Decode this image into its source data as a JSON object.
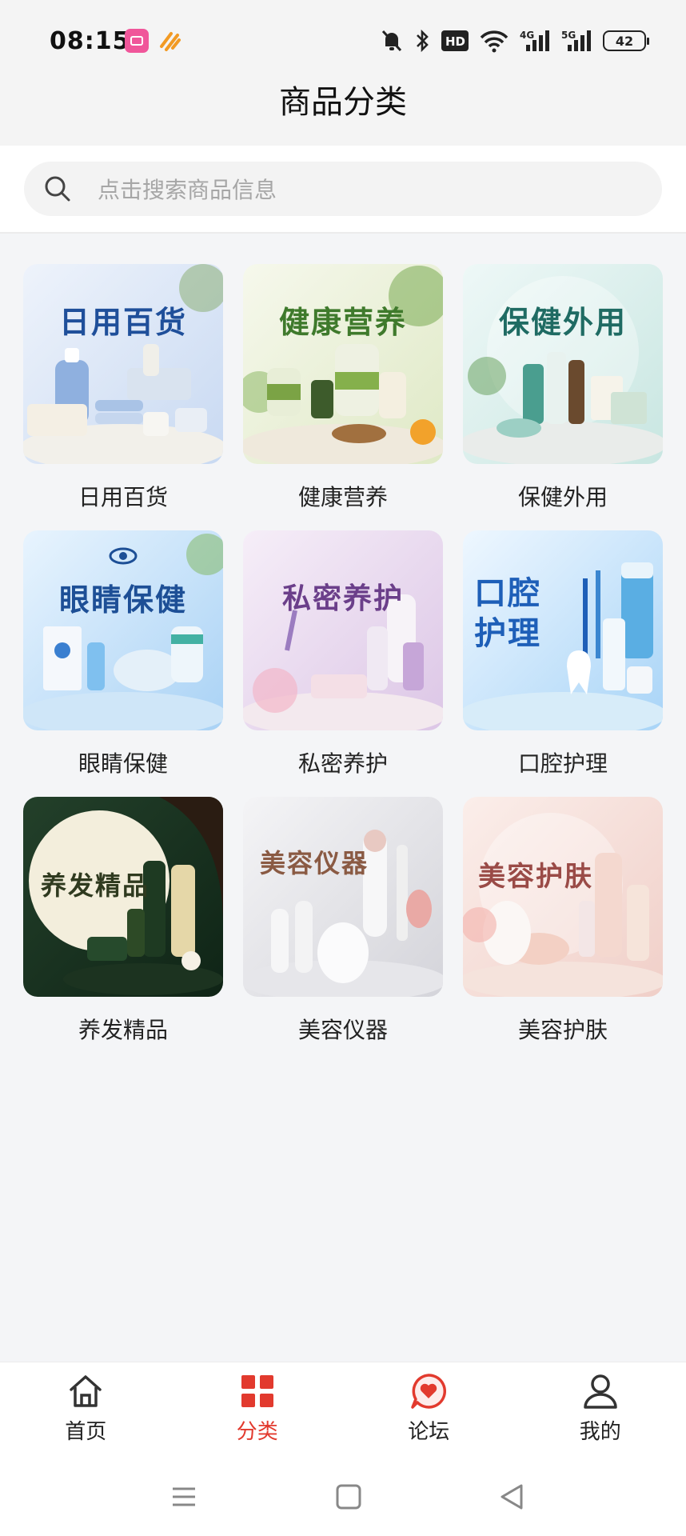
{
  "status_bar": {
    "time": "08:15",
    "battery": "42",
    "network_a": "4G",
    "network_b": "5G",
    "hd_badge": "HD"
  },
  "header": {
    "title": "商品分类"
  },
  "search": {
    "placeholder": "点击搜索商品信息"
  },
  "categories": [
    {
      "label": "日用百货",
      "banner": "日用百货",
      "theme": "#dfe9f7",
      "accent": "#1f4f9a"
    },
    {
      "label": "健康营养",
      "banner": "健康营养",
      "theme": "#eef4df",
      "accent": "#3f7a2c"
    },
    {
      "label": "保健外用",
      "banner": "保健外用",
      "theme": "#dff0ee",
      "accent": "#1f6b63"
    },
    {
      "label": "眼睛保健",
      "banner": "眼睛保健",
      "theme": "#d9ebfb",
      "accent": "#1d4f96"
    },
    {
      "label": "私密养护",
      "banner": "私密养护",
      "theme": "#eee3f3",
      "accent": "#6b3f8a"
    },
    {
      "label": "口腔护理",
      "banner": "口腔 护理",
      "theme": "#dcefff",
      "accent": "#1e5fb8"
    },
    {
      "label": "养发精品",
      "banner": "养发精品",
      "theme": "#e9e6d6",
      "accent": "#2f3a1f"
    },
    {
      "label": "美容仪器",
      "banner": "美容仪器",
      "theme": "#ececef",
      "accent": "#8a5a43"
    },
    {
      "label": "美容护肤",
      "banner": "美容护肤",
      "theme": "#f7e2de",
      "accent": "#9a4b47"
    }
  ],
  "bottom_nav": {
    "items": [
      {
        "label": "首页",
        "icon": "home-icon"
      },
      {
        "label": "分类",
        "icon": "category-grid-icon",
        "active": true
      },
      {
        "label": "论坛",
        "icon": "forum-heart-icon"
      },
      {
        "label": "我的",
        "icon": "user-icon"
      }
    ],
    "active_color": "#e23a2e"
  }
}
